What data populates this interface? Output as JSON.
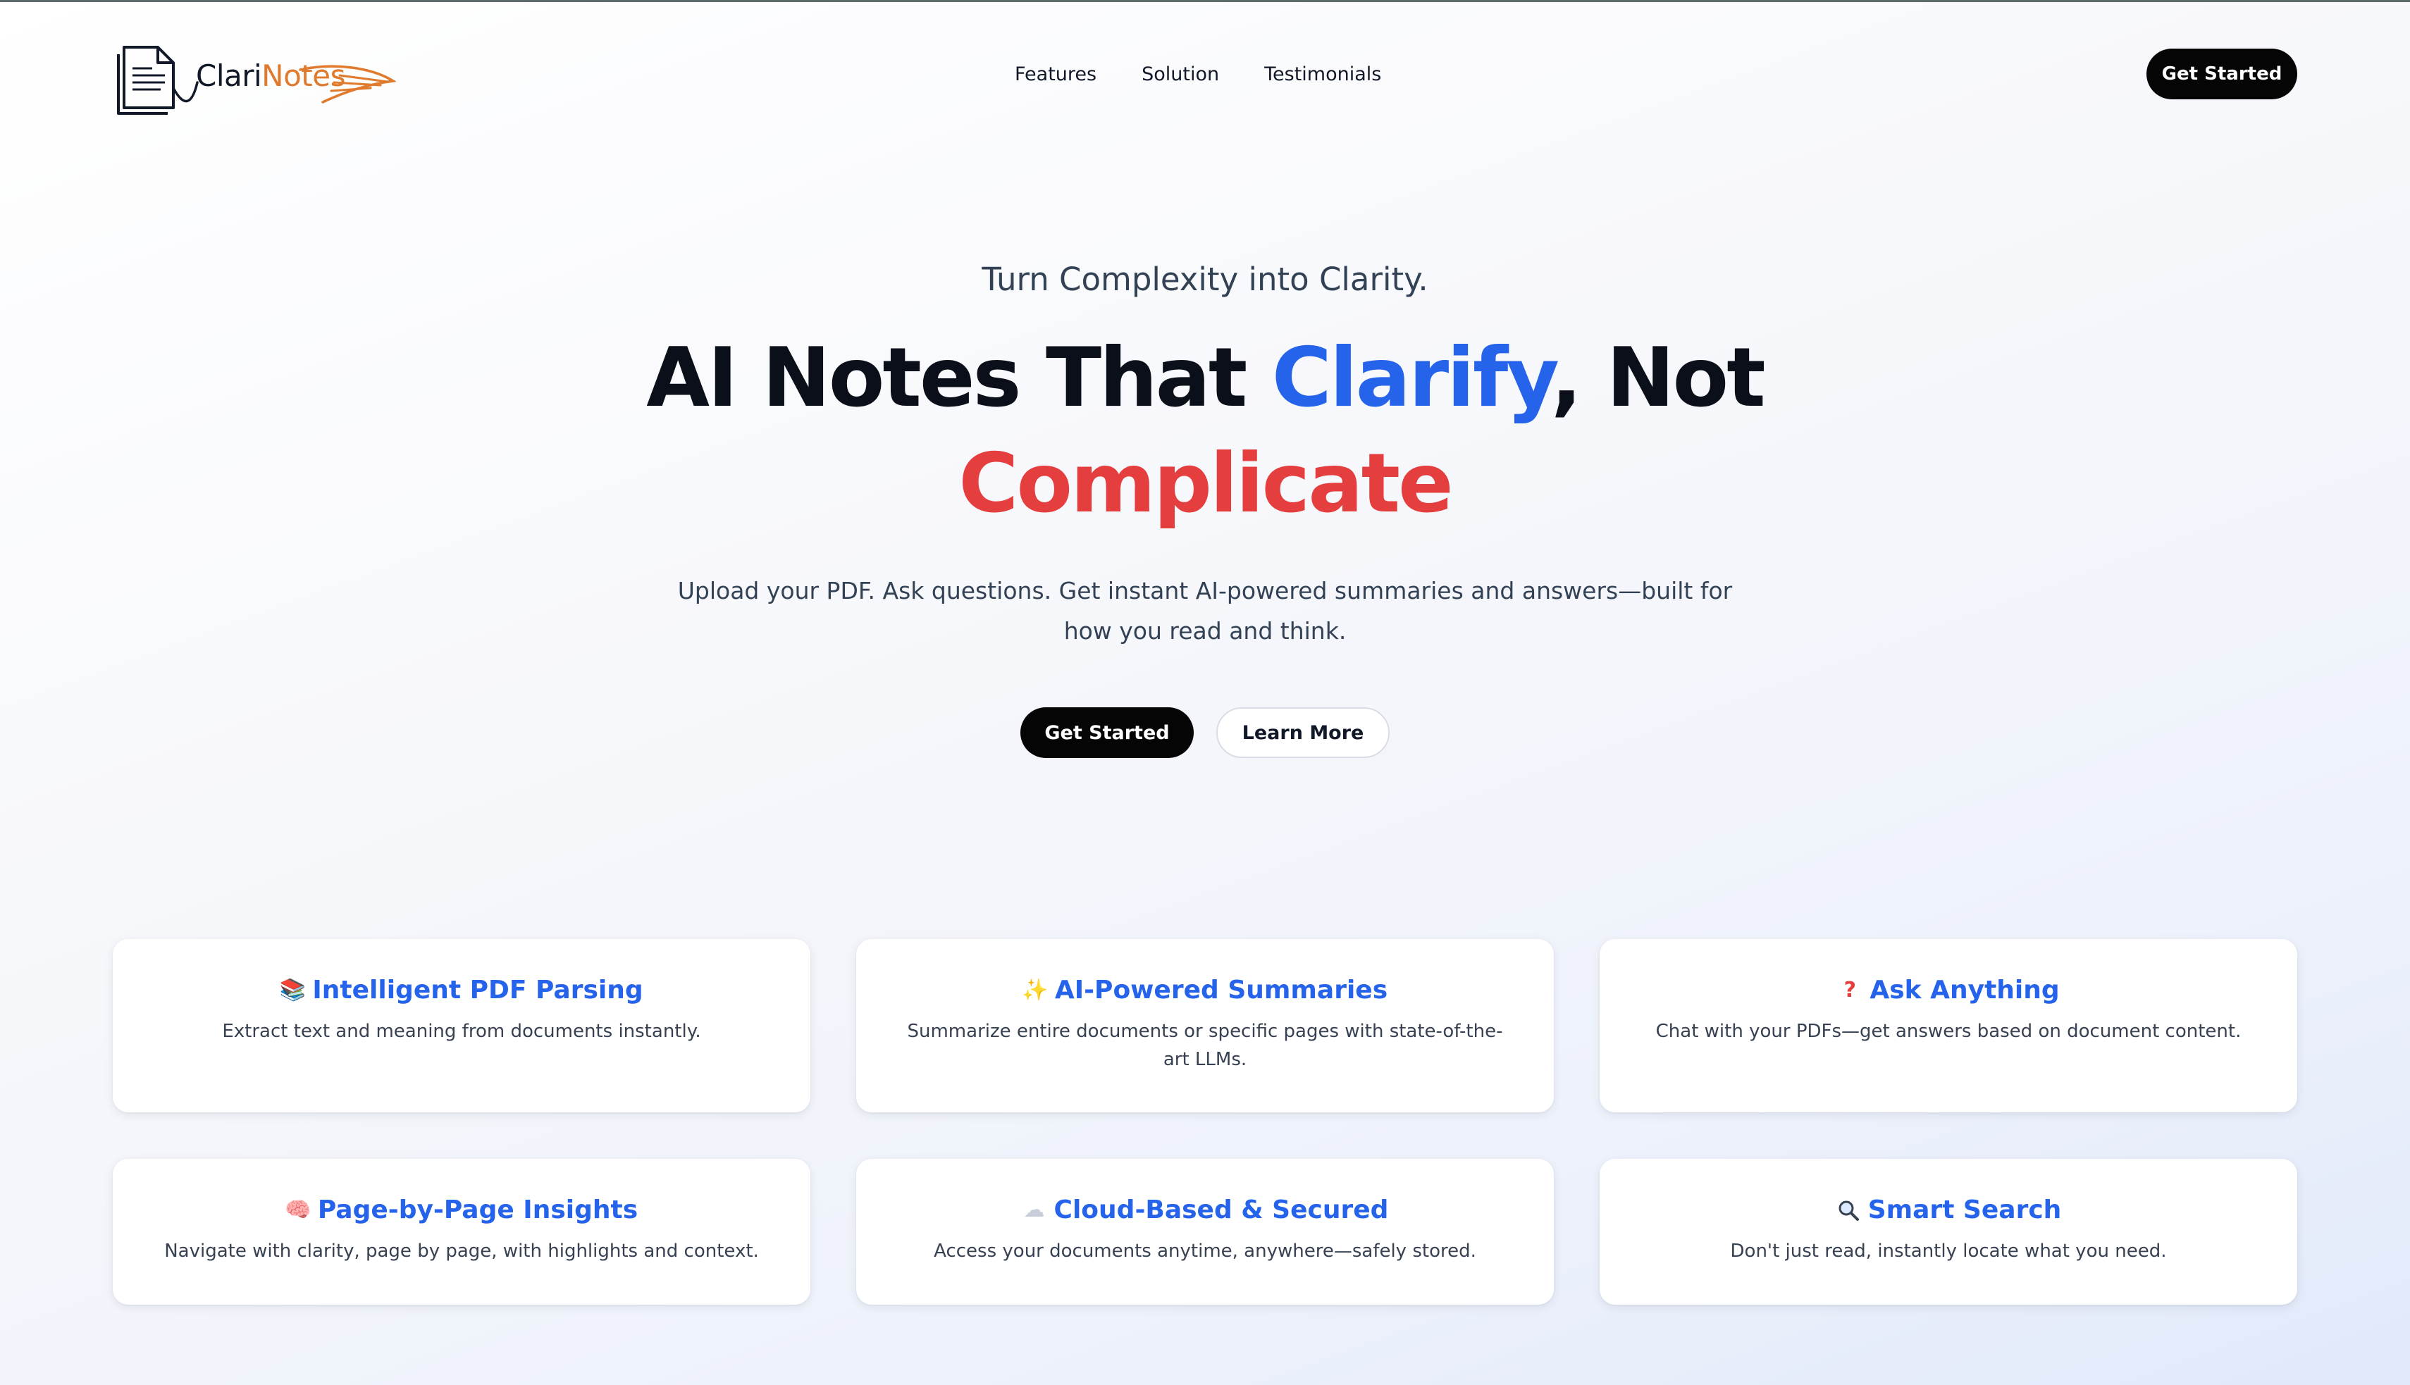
{
  "brand": {
    "name_part1": "Clari",
    "name_part2": "Notes",
    "accent_color": "#e07a2c"
  },
  "nav": {
    "items": [
      "Features",
      "Solution",
      "Testimonials"
    ]
  },
  "header": {
    "cta_label": "Get Started"
  },
  "hero": {
    "tagline": "Turn Complexity into Clarity.",
    "headline_part1": "AI Notes That ",
    "headline_highlight_blue": "Clarify",
    "headline_part2": ", Not",
    "headline_highlight_red": "Complicate",
    "subtext": "Upload your PDF. Ask questions. Get instant AI-powered summaries and answers—built for how you read and think.",
    "primary_cta": "Get Started",
    "secondary_cta": "Learn More",
    "colors": {
      "blue": "#2563eb",
      "red": "#e53e3e"
    }
  },
  "features": [
    {
      "icon": "books-icon",
      "title": "Intelligent PDF Parsing",
      "description": "Extract text and meaning from documents instantly."
    },
    {
      "icon": "sparkles-icon",
      "title": "AI-Powered Summaries",
      "description": "Summarize entire documents or specific pages with state-of-the-art LLMs."
    },
    {
      "icon": "question-mark-icon",
      "title": "Ask Anything",
      "description": "Chat with your PDFs—get answers based on document content."
    },
    {
      "icon": "brain-icon",
      "title": "Page-by-Page Insights",
      "description": "Navigate with clarity, page by page, with highlights and context."
    },
    {
      "icon": "cloud-icon",
      "title": "Cloud-Based & Secured",
      "description": "Access your documents anytime, anywhere—safely stored."
    },
    {
      "icon": "magnifying-glass-icon",
      "title": "Smart Search",
      "description": "Don't just read, instantly locate what you need."
    }
  ]
}
